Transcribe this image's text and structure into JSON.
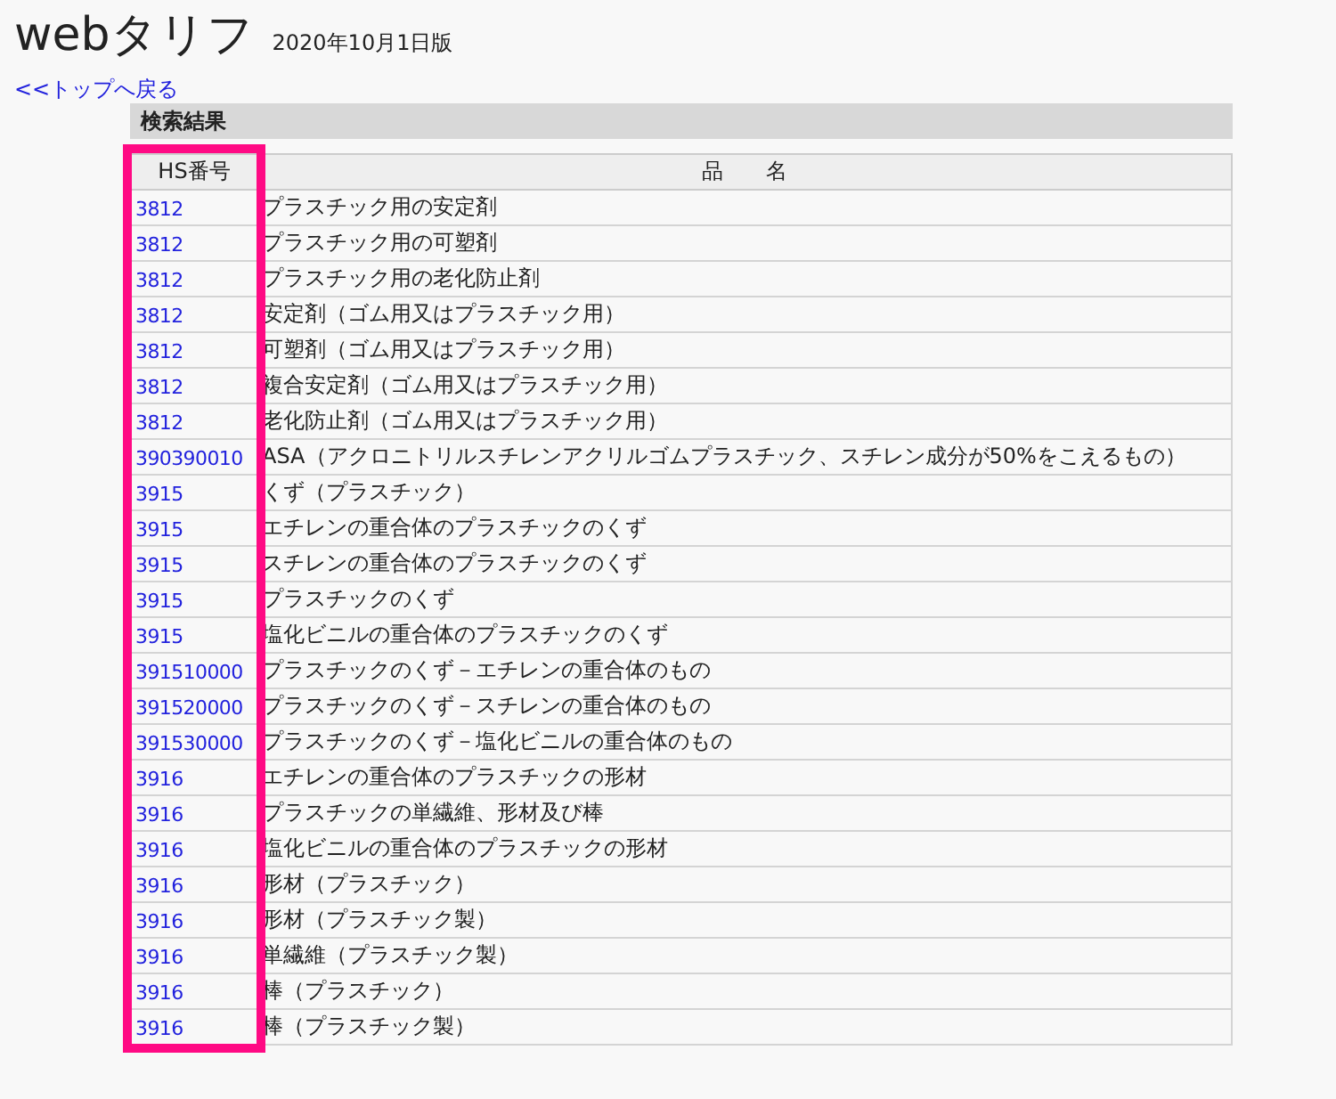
{
  "header": {
    "title": "webタリフ",
    "edition": "2020年10月1日版",
    "back_link": "<<トップへ戻る"
  },
  "section": {
    "title": "検索結果"
  },
  "table": {
    "columns": [
      {
        "label": "HS番号",
        "highlighted": true
      },
      {
        "label": "品　　名",
        "highlighted": false
      }
    ],
    "rows": [
      {
        "code": "3812",
        "name": "プラスチック用の安定剤"
      },
      {
        "code": "3812",
        "name": "プラスチック用の可塑剤"
      },
      {
        "code": "3812",
        "name": "プラスチック用の老化防止剤"
      },
      {
        "code": "3812",
        "name": "安定剤（ゴム用又はプラスチック用）"
      },
      {
        "code": "3812",
        "name": "可塑剤（ゴム用又はプラスチック用）"
      },
      {
        "code": "3812",
        "name": "複合安定剤（ゴム用又はプラスチック用）"
      },
      {
        "code": "3812",
        "name": "老化防止剤（ゴム用又はプラスチック用）"
      },
      {
        "code": "390390010",
        "name": "ASA（アクロニトリルスチレンアクリルゴムプラスチック、スチレン成分が50%をこえるもの）"
      },
      {
        "code": "3915",
        "name": "くず（プラスチック）"
      },
      {
        "code": "3915",
        "name": "エチレンの重合体のプラスチックのくず"
      },
      {
        "code": "3915",
        "name": "スチレンの重合体のプラスチックのくず"
      },
      {
        "code": "3915",
        "name": "プラスチックのくず"
      },
      {
        "code": "3915",
        "name": "塩化ビニルの重合体のプラスチックのくず"
      },
      {
        "code": "391510000",
        "name": "プラスチックのくず－エチレンの重合体のもの"
      },
      {
        "code": "391520000",
        "name": "プラスチックのくず－スチレンの重合体のもの"
      },
      {
        "code": "391530000",
        "name": "プラスチックのくず－塩化ビニルの重合体のもの"
      },
      {
        "code": "3916",
        "name": "エチレンの重合体のプラスチックの形材"
      },
      {
        "code": "3916",
        "name": "プラスチックの単繊維、形材及び棒"
      },
      {
        "code": "3916",
        "name": "塩化ビニルの重合体のプラスチックの形材"
      },
      {
        "code": "3916",
        "name": "形材（プラスチック）"
      },
      {
        "code": "3916",
        "name": "形材（プラスチック製）"
      },
      {
        "code": "3916",
        "name": "単繊維（プラスチック製）"
      },
      {
        "code": "3916",
        "name": "棒（プラスチック）"
      },
      {
        "code": "3916",
        "name": "棒（プラスチック製）"
      }
    ]
  }
}
